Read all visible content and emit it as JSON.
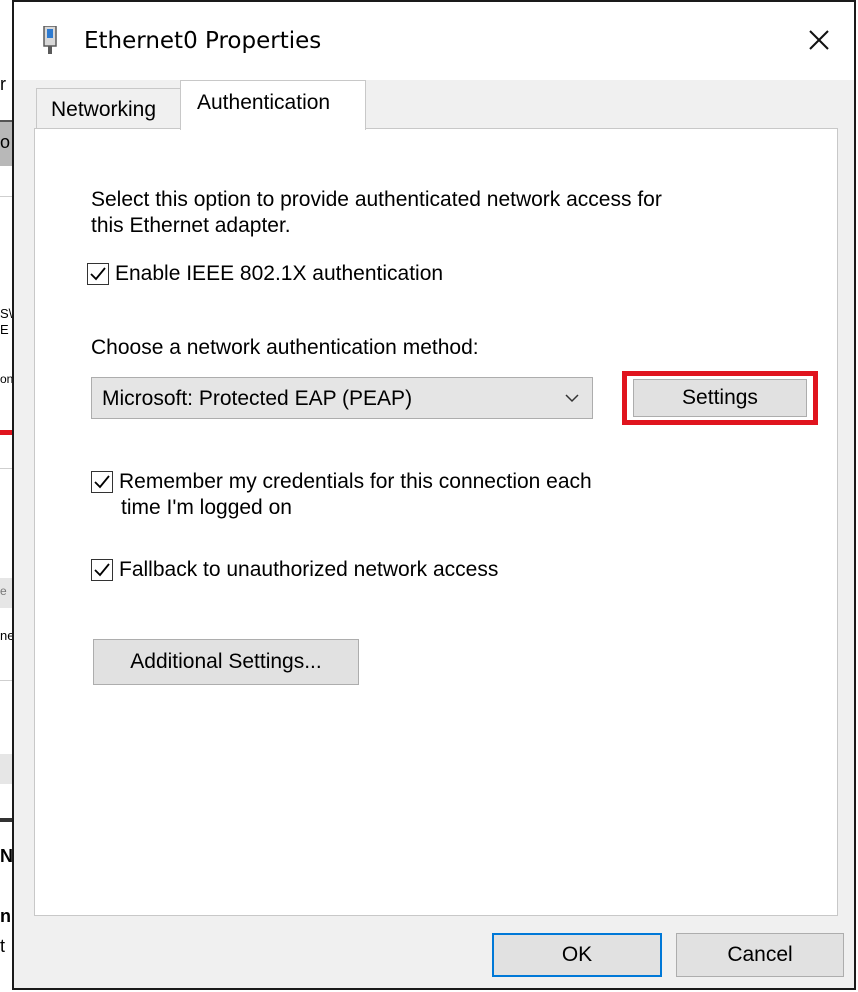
{
  "background": {
    "fragments": [
      "r",
      "o",
      "S\\",
      "E",
      "on",
      "e",
      "ne",
      "N",
      "n",
      "t"
    ]
  },
  "dialog": {
    "title": "Ethernet0 Properties",
    "title_icon": "network-adapter-icon",
    "close_icon": "close-icon"
  },
  "tabs": {
    "networking": "Networking",
    "authentication": "Authentication"
  },
  "authentication": {
    "description_line1": "Select this option to provide authenticated network access for",
    "description_line2": "this Ethernet adapter.",
    "enable_8021x": {
      "label": "Enable IEEE 802.1X authentication",
      "checked": true
    },
    "method_label": "Choose a network authentication method:",
    "method_selected": "Microsoft: Protected EAP (PEAP)",
    "settings_button": "Settings",
    "remember_credentials": {
      "label_line1": "Remember my credentials for this connection each",
      "label_line2": "time I'm logged on",
      "checked": true
    },
    "fallback": {
      "label": "Fallback to unauthorized network access",
      "checked": true
    },
    "additional_settings_button": "Additional Settings..."
  },
  "footer": {
    "ok": "OK",
    "cancel": "Cancel"
  },
  "colors": {
    "highlight": "#e0141e",
    "default_button_border": "#0078d7"
  }
}
